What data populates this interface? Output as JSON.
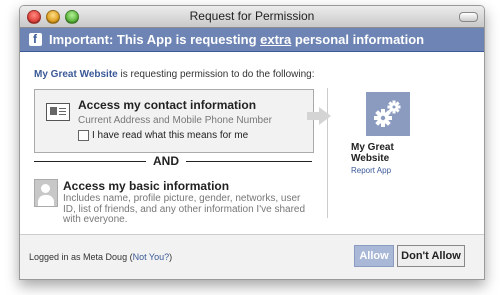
{
  "window": {
    "title": "Request for Permission"
  },
  "facebook_bar": {
    "logo_letter": "f",
    "title_before": "Important: This App is requesting ",
    "title_extra": "extra",
    "title_after": " personal information"
  },
  "intro": {
    "site": "My Great Website",
    "text": " is requesting permission to do the following:"
  },
  "contact": {
    "title": "Access my contact information",
    "subtitle": "Current Address and Mobile Phone Number",
    "checkbox_label": "I have read what this means for me"
  },
  "and_label": "AND",
  "basic": {
    "title": "Access my basic information",
    "description": "Includes name, profile picture, gender, networks, user ID, list of friends, and any other information I've shared with everyone."
  },
  "app": {
    "name": "My Great Website",
    "report": "Report App"
  },
  "footer": {
    "logged_prefix": "Logged in as Meta Doug (",
    "not_you": "Not You?",
    "logged_suffix": ")"
  },
  "buttons": {
    "allow": "Allow",
    "dont_allow": "Don't Allow"
  },
  "colors": {
    "facebook_blue": "#3b5998",
    "bar": "#6d84b4",
    "app_icon": "#8b9bc0"
  }
}
